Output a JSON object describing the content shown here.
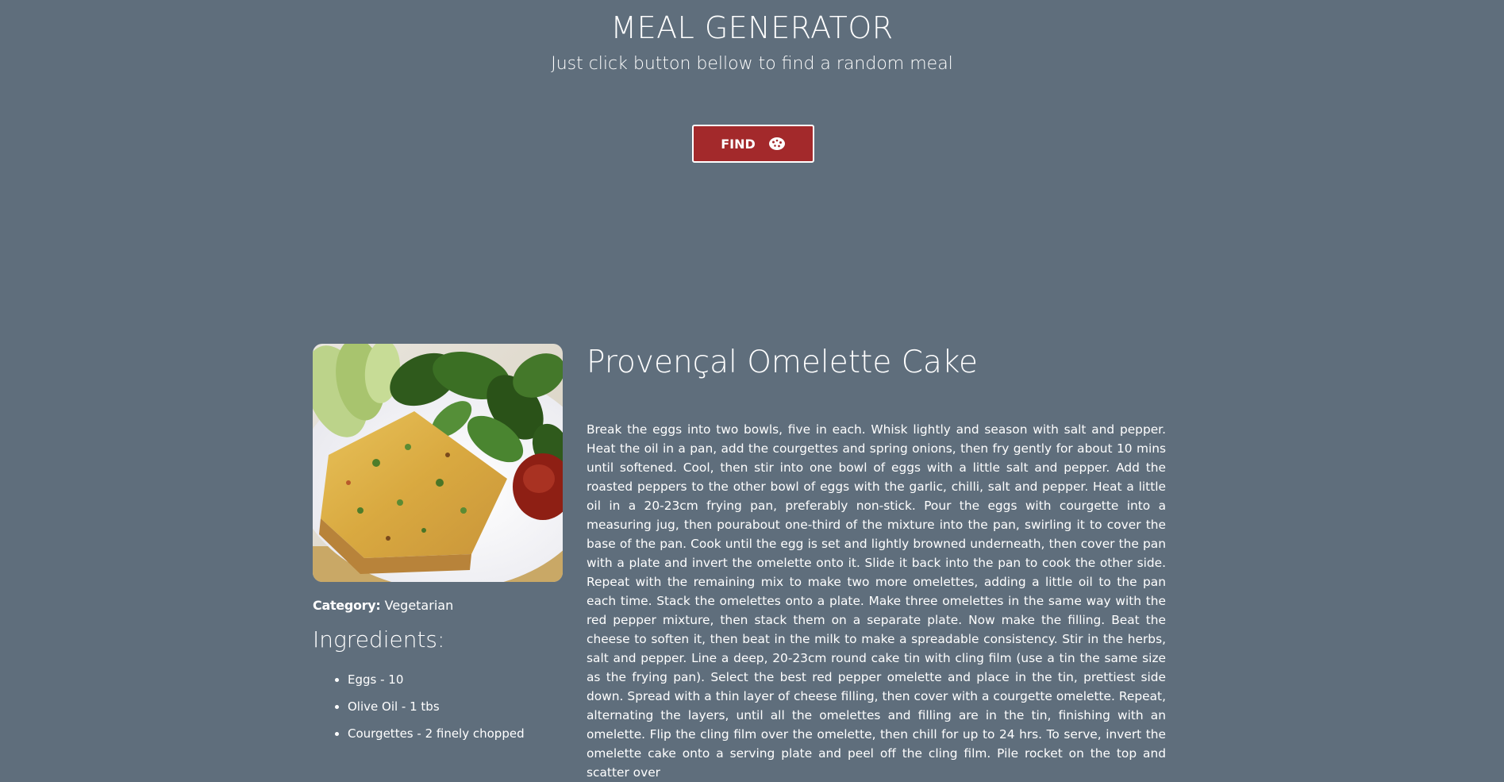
{
  "header": {
    "title": "MEAL GENERATOR",
    "subtitle": "Just click button bellow to find a random meal"
  },
  "find_button": {
    "label": "FIND",
    "icon": "cookie-icon",
    "color": "#a3292b"
  },
  "meal": {
    "name": "Provençal Omelette Cake",
    "image": "meal-photo",
    "category_label": "Category:",
    "category_value": "Vegetarian",
    "ingredients_title": "Ingredients:",
    "ingredients": [
      "Eggs - 10",
      "Olive Oil - 1 tbs",
      "Courgettes - 2 finely chopped"
    ],
    "instructions": "Break the eggs into two bowls, five in each. Whisk lightly and season with salt and pepper. Heat the oil in a pan, add the courgettes and spring onions, then fry gently for about 10 mins until softened. Cool, then stir into one bowl of eggs with a little salt and pepper. Add the roasted peppers to the other bowl of eggs with the garlic, chilli, salt and pepper. Heat a little oil in a 20-23cm frying pan, preferably non-stick. Pour the eggs with courgette into a measuring jug, then pourabout one-third of the mixture into the pan, swirling it to cover the base of the pan. Cook until the egg is set and lightly browned underneath, then cover the pan with a plate and invert the omelette onto it. Slide it back into the pan to cook the other side. Repeat with the remaining mix to make two more omelettes, adding a little oil to the pan each time. Stack the omelettes onto a plate. Make three omelettes in the same way with the red pepper mixture, then stack them on a separate plate. Now make the filling. Beat the cheese to soften it, then beat in the milk to make a spreadable consistency. Stir in the herbs, salt and pepper. Line a deep, 20-23cm round cake tin with cling film (use a tin the same size as the frying pan). Select the best red pepper omelette and place in the tin, prettiest side down. Spread with a thin layer of cheese filling, then cover with a courgette omelette. Repeat, alternating the layers, until all the omelettes and filling are in the tin, finishing with an omelette. Flip the cling film over the omelette, then chill for up to 24 hrs. To serve, invert the omelette cake onto a serving plate and peel off the cling film. Pile rocket on the top and scatter over"
  },
  "colors": {
    "background": "#5f6e7c",
    "accent": "#a3292b",
    "text": "#ffffff"
  }
}
